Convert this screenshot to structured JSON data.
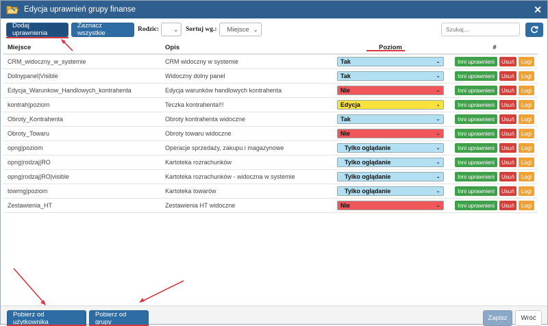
{
  "window": {
    "title": "Edycja uprawnień grupy finanse"
  },
  "toolbar": {
    "add_label": "Dodaj uprawnienia",
    "select_all_label": "Zaznacz wszystkie",
    "type_label": "Rodzic:",
    "type_value": "",
    "sort_label": "Sortuj wg.:",
    "sort_value": "Miejsce",
    "search_placeholder": "Szukaj..."
  },
  "columns": {
    "place": "Miejsce",
    "desc": "Opis",
    "level": "Poziom",
    "actions": "#"
  },
  "row_actions": {
    "others": "Inni uprawnieni",
    "delete": "Usuń",
    "logs": "Logi"
  },
  "level_colors": {
    "Tak": "#b3dff2",
    "Nie": "#f0575a",
    "Edycja": "#fae13c",
    "Tylko oglądanie": "#b3dff2"
  },
  "rows": [
    {
      "place": "CRM_widoczny_w_systemie",
      "desc": "CRM widoczny w systemie",
      "level": "Tak"
    },
    {
      "place": "Dolnypanel|Visible",
      "desc": "Widoczny dolny panel",
      "level": "Tak"
    },
    {
      "place": "Edycja_Warunkow_Handlowych_kontrahenta",
      "desc": "Edycja warunków handlowych kontrahenta",
      "level": "Nie"
    },
    {
      "place": "kontrah|poziom",
      "desc": "Teczka kontrahenta!!!",
      "level": "Edycja"
    },
    {
      "place": "Obroty_Kontrahenta",
      "desc": "Obroty kontrahenta widoczne",
      "level": "Tak"
    },
    {
      "place": "Obroty_Towaru",
      "desc": "Obroty towaru widoczne",
      "level": "Nie"
    },
    {
      "place": "opng|poziom",
      "desc": "Operacje sprzedaży, zakupu i magazynowe",
      "level": "Tylko oglądanie"
    },
    {
      "place": "opng|rodzaj|RO",
      "desc": "Kartoteka rozrachunków",
      "level": "Tylko oglądanie"
    },
    {
      "place": "opng|rodzaj|RO|visible",
      "desc": "Kartoteka rozrachunków - widoczna w systemie",
      "level": "Tylko oglądanie"
    },
    {
      "place": "towrng|poziom",
      "desc": "Kartoteka towarów",
      "level": "Tylko oglądanie"
    },
    {
      "place": "Zestawienia_HT",
      "desc": "Zestawienia HT widoczne",
      "level": "Nie"
    }
  ],
  "footer": {
    "from_user_label": "Pobierz od użytkownika",
    "from_group_label": "Pobierz od grupy",
    "save_label": "Zapisz",
    "back_label": "Wróć"
  }
}
